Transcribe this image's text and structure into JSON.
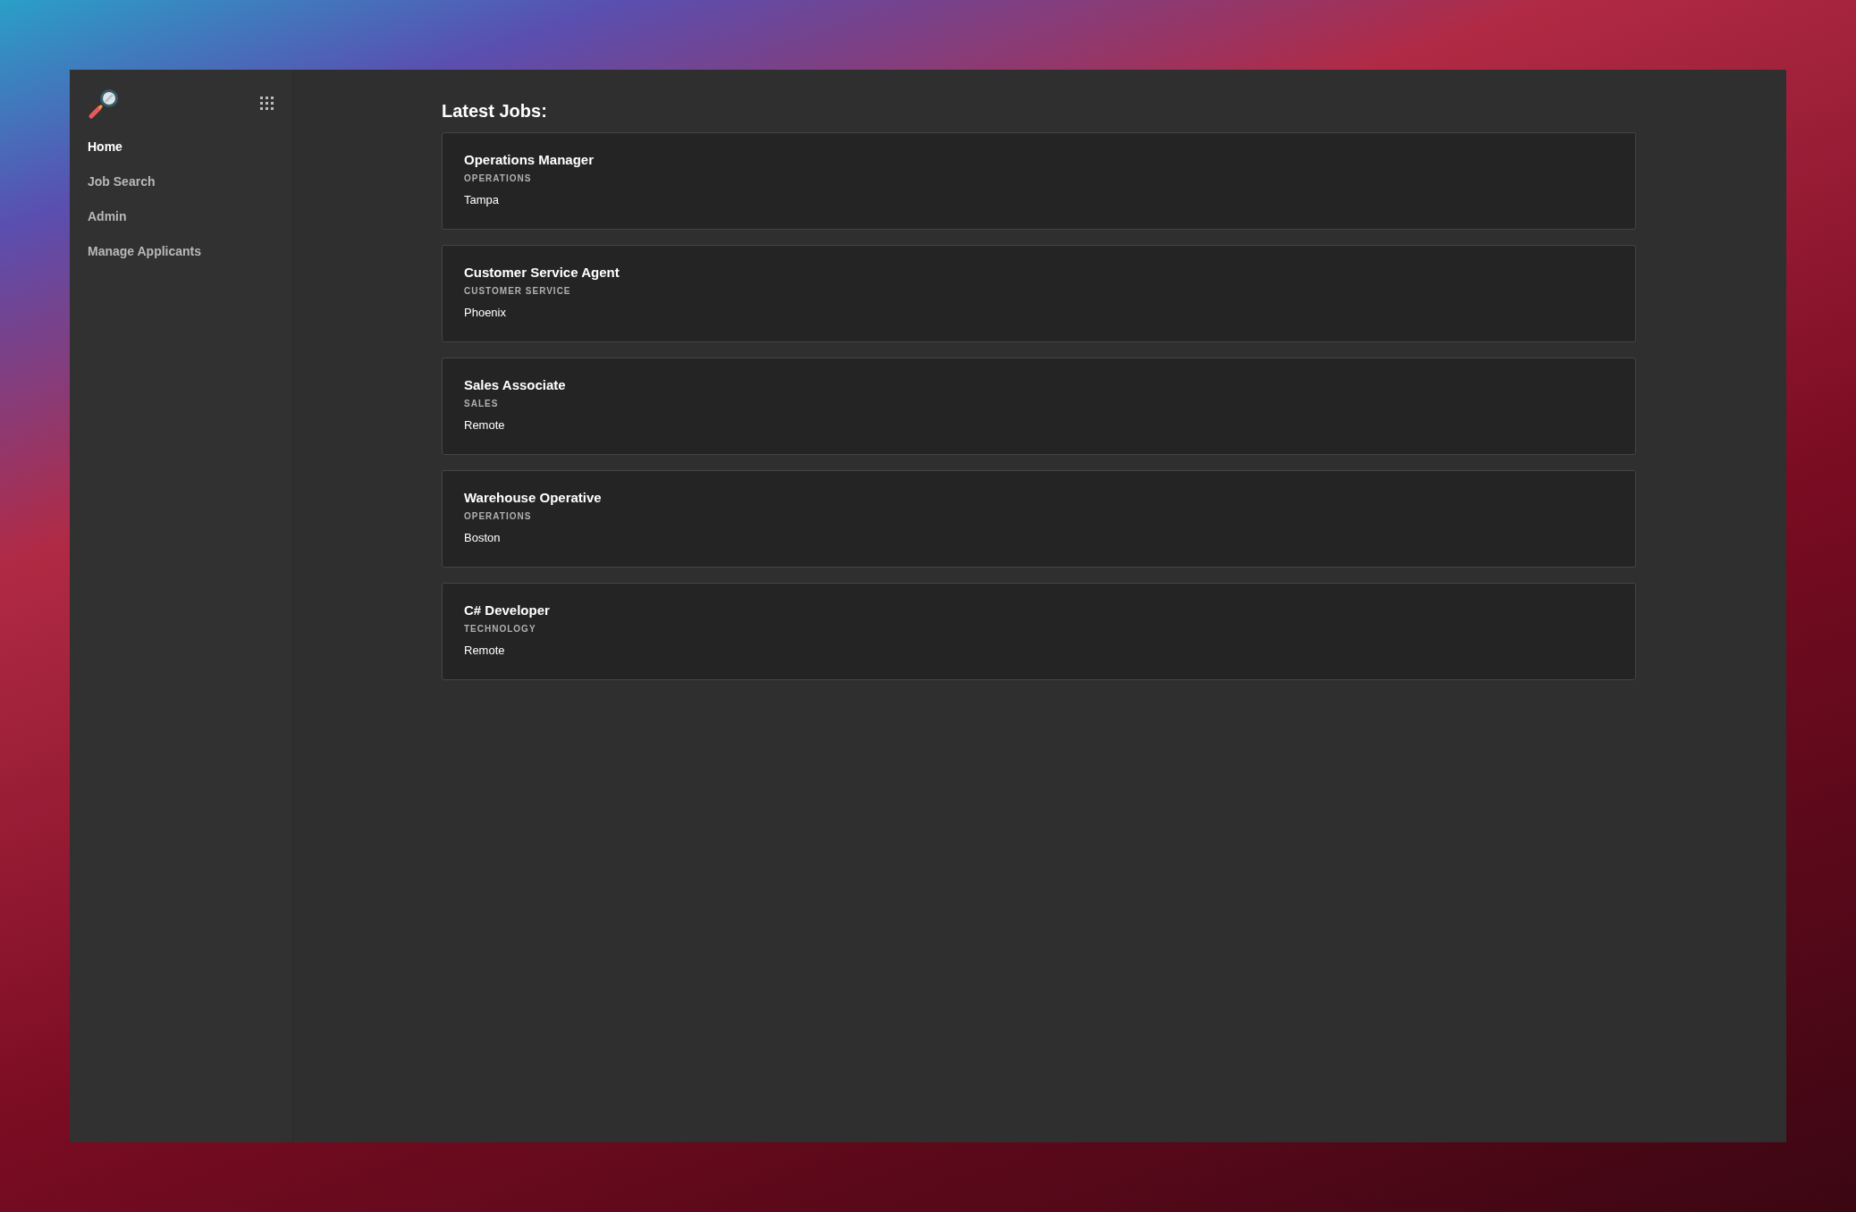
{
  "sidebar": {
    "items": [
      {
        "label": "Home",
        "selected": true
      },
      {
        "label": "Job Search",
        "selected": false
      },
      {
        "label": "Admin",
        "selected": false
      },
      {
        "label": "Manage Applicants",
        "selected": false
      }
    ]
  },
  "main": {
    "heading": "Latest Jobs:",
    "jobs": [
      {
        "title": "Operations Manager",
        "category": "OPERATIONS",
        "location": "Tampa"
      },
      {
        "title": "Customer Service Agent",
        "category": "CUSTOMER SERVICE",
        "location": "Phoenix"
      },
      {
        "title": "Sales Associate",
        "category": "SALES",
        "location": "Remote"
      },
      {
        "title": "Warehouse Operative",
        "category": "OPERATIONS",
        "location": "Boston"
      },
      {
        "title": "C# Developer",
        "category": "TECHNOLOGY",
        "location": "Remote"
      }
    ]
  }
}
